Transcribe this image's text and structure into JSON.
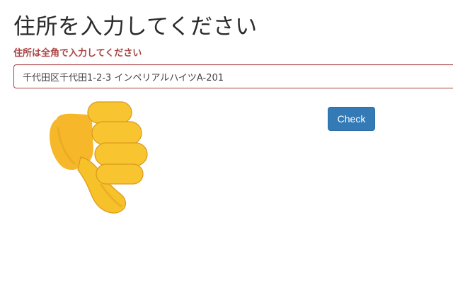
{
  "page": {
    "title": "住所を入力してください",
    "error_message": "住所は全角で入力してください"
  },
  "address_field": {
    "value": "千代田区千代田1-2-3 インペリアルハイツA-201"
  },
  "check_button": {
    "label": "Check"
  },
  "overlay": {
    "icon": "thumbs-down-icon"
  },
  "colors": {
    "error": "#a94442",
    "button": "#337ab7",
    "emoji": "#f7c12a"
  }
}
